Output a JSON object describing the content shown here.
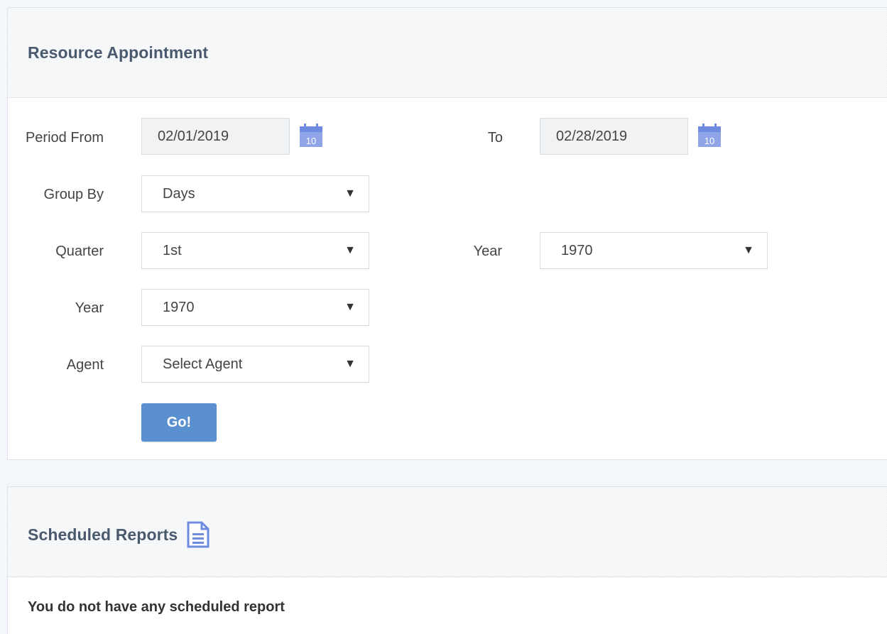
{
  "resource_appointment": {
    "title": "Resource Appointment",
    "period_from_label": "Period From",
    "period_from_value": "02/01/2019",
    "to_label": "To",
    "to_value": "02/28/2019",
    "calendar_icon": "calendar-icon",
    "calendar_day": "10",
    "group_by_label": "Group By",
    "group_by_value": "Days",
    "quarter_label": "Quarter",
    "quarter_value": "1st",
    "quarter_year_label": "Year",
    "quarter_year_value": "1970",
    "year_label": "Year",
    "year_value": "1970",
    "agent_label": "Agent",
    "agent_value": "Select Agent",
    "go_label": "Go!",
    "caret": "▼"
  },
  "scheduled_reports": {
    "title": "Scheduled Reports",
    "icon": "document-icon",
    "empty_message": "You do not have any scheduled report"
  },
  "colors": {
    "accent": "#5a8fd0",
    "title": "#4a5a6e",
    "icon": "#6f8be0"
  }
}
